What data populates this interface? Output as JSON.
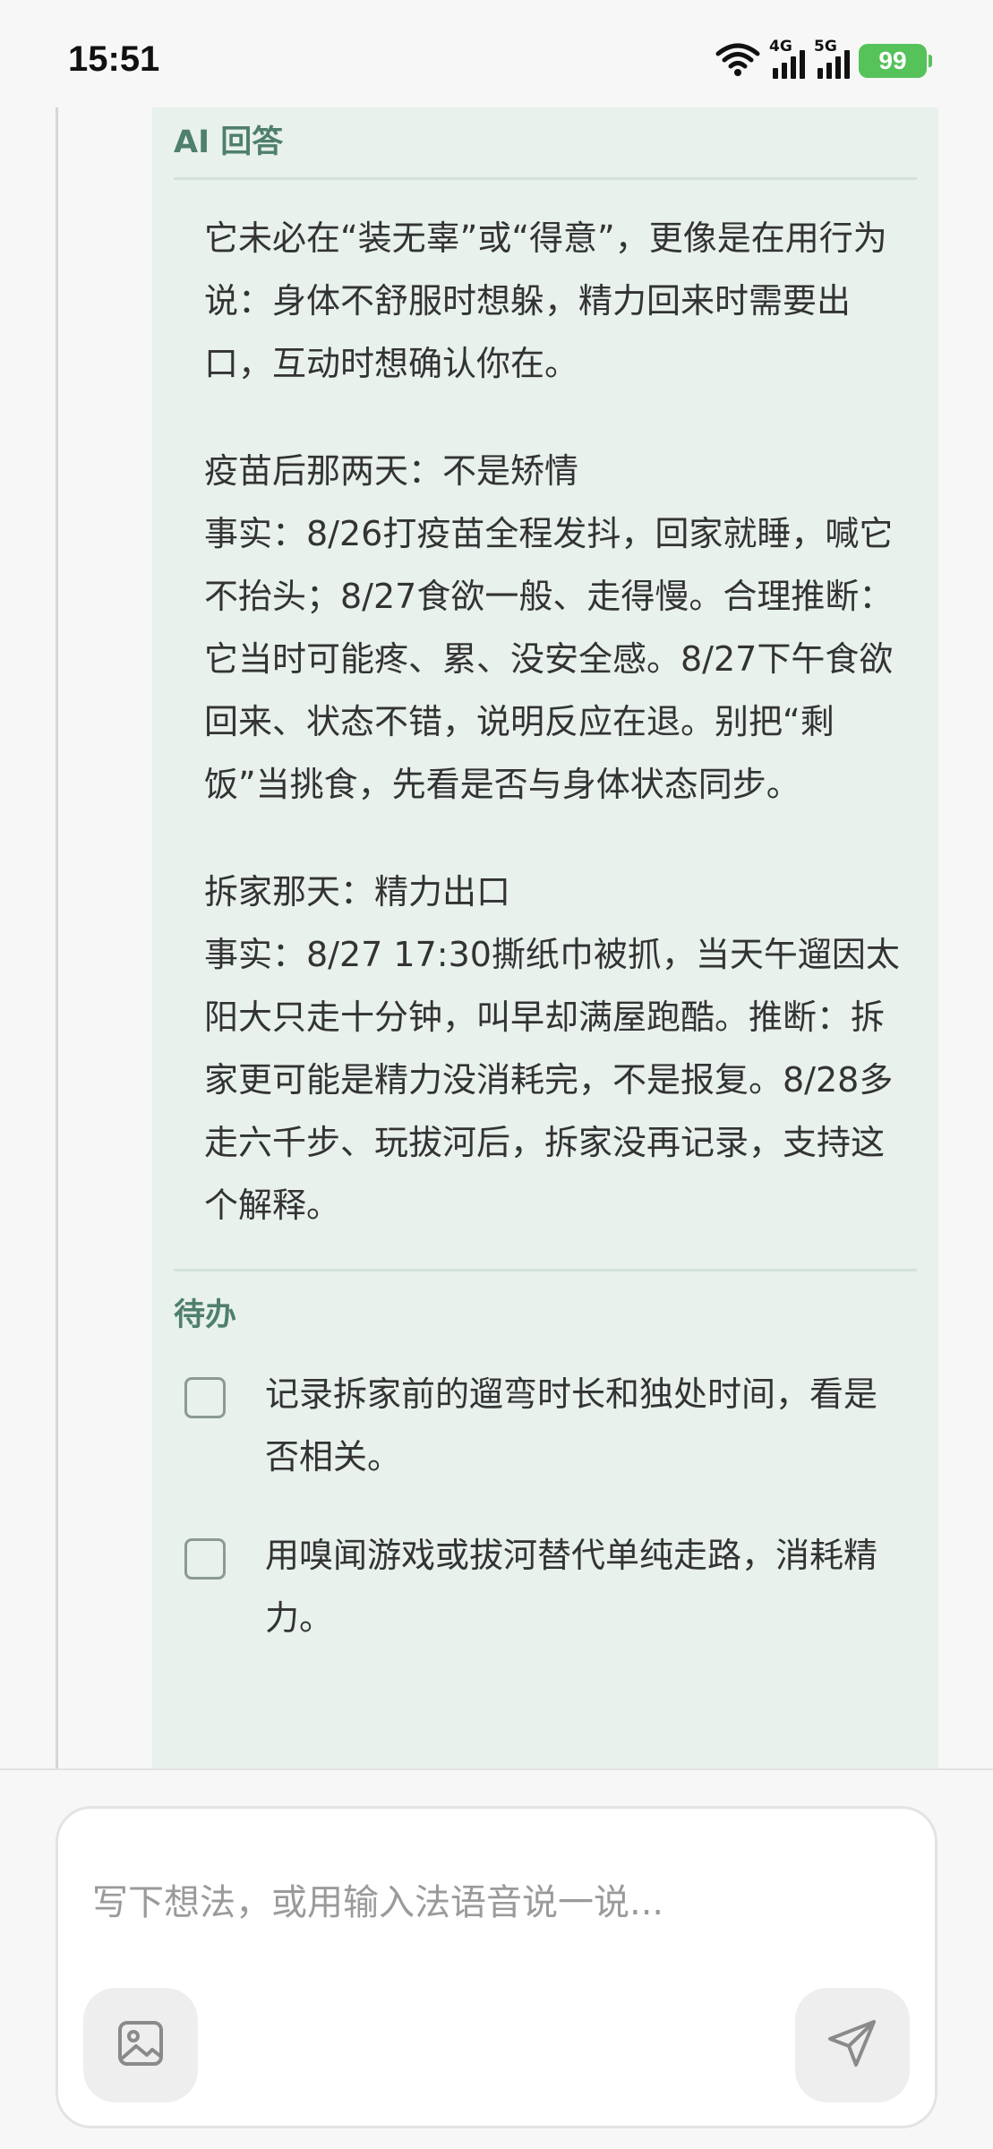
{
  "status_bar": {
    "time": "15:51",
    "network_4g": "4G",
    "network_5g": "5G",
    "battery": "99"
  },
  "answer": {
    "title": "AI 回答",
    "paragraphs": [
      "它未必在“装无辜”或“得意”，更像是在用行为说：身体不舒服时想躲，精力回来时需要出口，互动时想确认你在。",
      "疫苗后那两天：不是矫情",
      "事实：8/26打疫苗全程发抖，回家就睡，喊它不抬头；8/27食欲一般、走得慢。合理推断：它当时可能疼、累、没安全感。8/27下午食欲回来、状态不错，说明反应在退。别把“剩饭”当挑食，先看是否与身体状态同步。",
      "拆家那天：精力出口",
      "事实：8/27 17:30撕纸巾被抓，当天午遛因太阳大只走十分钟，叫早却满屋跑酷。推断：拆家更可能是精力没消耗完，不是报复。8/28多走六千步、玩拔河后，拆家没再记录，支持这个解释。"
    ]
  },
  "todo": {
    "title": "待办",
    "items": [
      "记录拆家前的遛弯时长和独处时间，看是否相关。",
      "用嗅闻游戏或拔河替代单纯走路，消耗精力。"
    ]
  },
  "composer": {
    "placeholder": "写下想法，或用输入法语音说一说..."
  },
  "icons": {
    "image_button": "image-icon",
    "send_button": "send-icon"
  }
}
